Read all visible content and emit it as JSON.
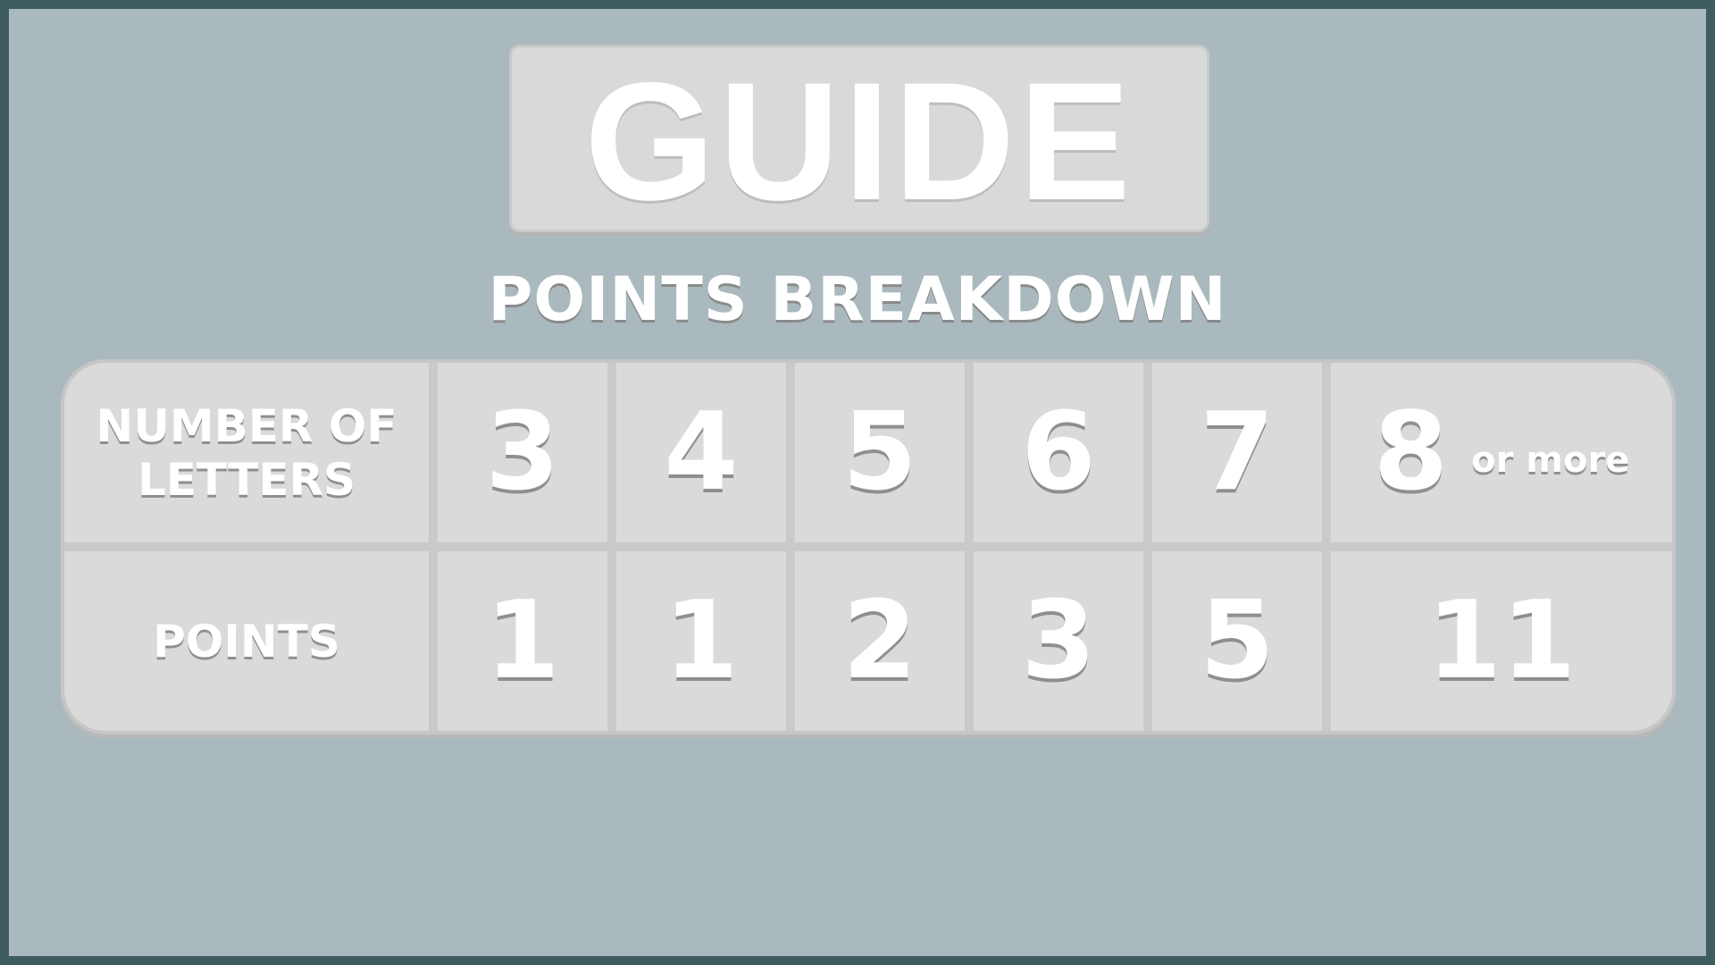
{
  "title": "GUIDE",
  "subtitle": "POINTS BREAKDOWN",
  "table": {
    "letters_label_line1": "NUMBER OF",
    "letters_label_line2": "LETTERS",
    "points_label": "POINTS",
    "columns": [
      {
        "letters": "3",
        "points": "1"
      },
      {
        "letters": "4",
        "points": "1"
      },
      {
        "letters": "5",
        "points": "2"
      },
      {
        "letters": "6",
        "points": "3"
      },
      {
        "letters": "7",
        "points": "5"
      },
      {
        "letters": "8",
        "letters_suffix": "or more",
        "points": "11"
      }
    ]
  }
}
